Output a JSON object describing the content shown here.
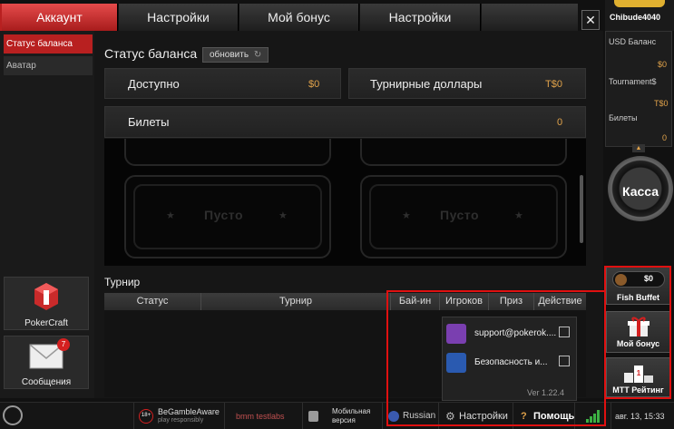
{
  "tabs": [
    "Аккаунт",
    "Настройки",
    "Мой бонус",
    "Настройки"
  ],
  "close_glyph": "✕",
  "left_nav": {
    "items": [
      "Статус баланса",
      "Аватар"
    ],
    "pokercraft": "PokerCraft",
    "messages": "Сообщения",
    "messages_count": "7"
  },
  "main": {
    "title": "Статус баланса",
    "refresh": "обновить",
    "available_label": "Доступно",
    "available_value": "$0",
    "tournament_dollars_label": "Турнирные доллары",
    "tournament_dollars_value": "T$0",
    "tickets_label": "Билеты",
    "tickets_value": "0",
    "ticket_empty_1": "Пусто",
    "ticket_empty_2": "Пусто",
    "star": "★",
    "tournament_title": "Турнир",
    "columns": [
      "Статус",
      "Турнир",
      "Бай-ин",
      "Игроков",
      "Приз",
      "Действие"
    ]
  },
  "right": {
    "username": "Chibude4040",
    "usd_label": "USD Баланс",
    "usd_value": "$0",
    "tournament_label": "Tournament$",
    "tournament_value": "T$0",
    "tickets_label": "Билеты",
    "tickets_value": "0",
    "cashier": "Касса",
    "fish_buffet_value": "$0",
    "fish_buffet": "Fish Buffet",
    "my_bonus": "Мой бонус",
    "mtt_rating": "MTT Рейтинг"
  },
  "popup": {
    "support": "support@pokerok....",
    "security": "Безопасность и...",
    "version": "Ver 1.22.4"
  },
  "bottom": {
    "age": "18+",
    "gamble_aware": "BeGambleAware",
    "gamble_aware_sub": "play responsibly",
    "testlabs": "bmm testlabs",
    "mobile_1": "Мобильная",
    "mobile_2": "версия",
    "language": "Russian",
    "settings": "Настройки",
    "help": "Помощь",
    "datetime": "авг. 13, 15:33"
  },
  "colors": {
    "accent_red": "#b82020",
    "value_orange": "#e0a24a",
    "highlight_box": "#e01010"
  }
}
